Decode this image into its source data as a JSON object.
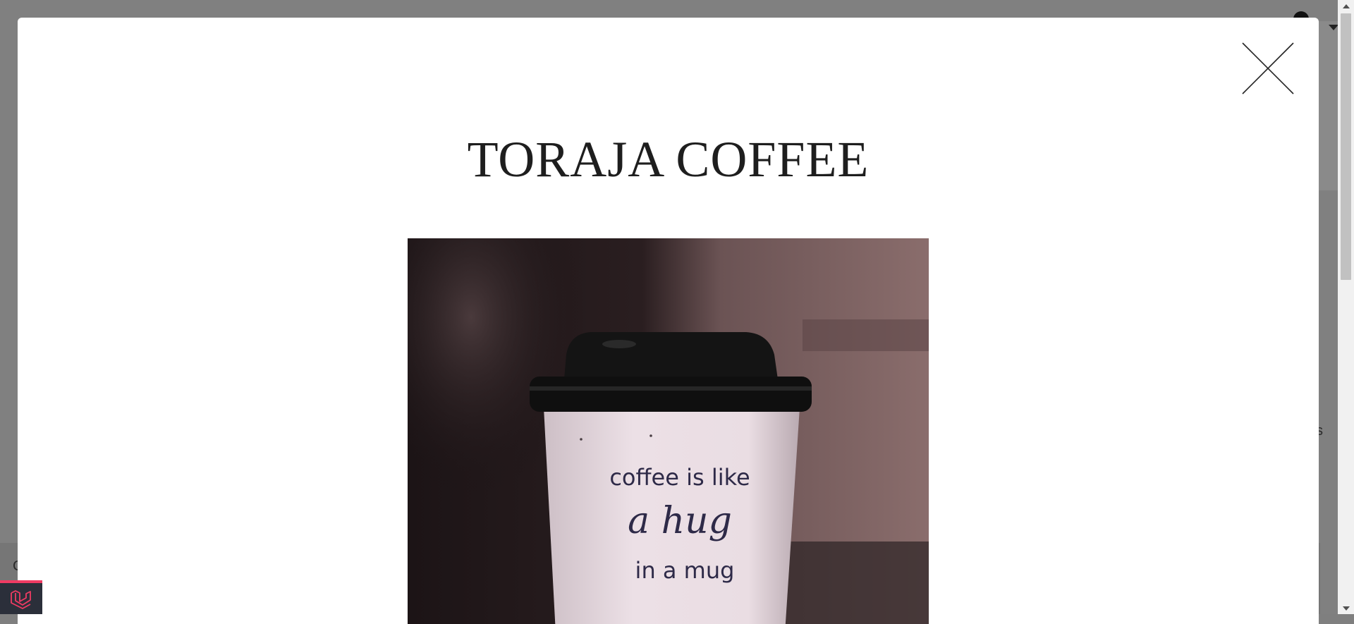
{
  "modal": {
    "title": "TORAJA COFFEE",
    "close_icon": "close-icon"
  },
  "photo": {
    "cup_line1": "coffee is like",
    "cup_line2": "a hug",
    "cup_line3": "in a mug"
  },
  "background": {
    "letter_right": "s",
    "letter_left": "C",
    "badge_icon": "laravel-logo-icon"
  },
  "colors": {
    "overlay": "#808080",
    "modal_bg": "#ffffff",
    "title": "#1e1e1e",
    "badge_bg": "#2b2f3a",
    "badge_accent": "#ef3b63"
  }
}
